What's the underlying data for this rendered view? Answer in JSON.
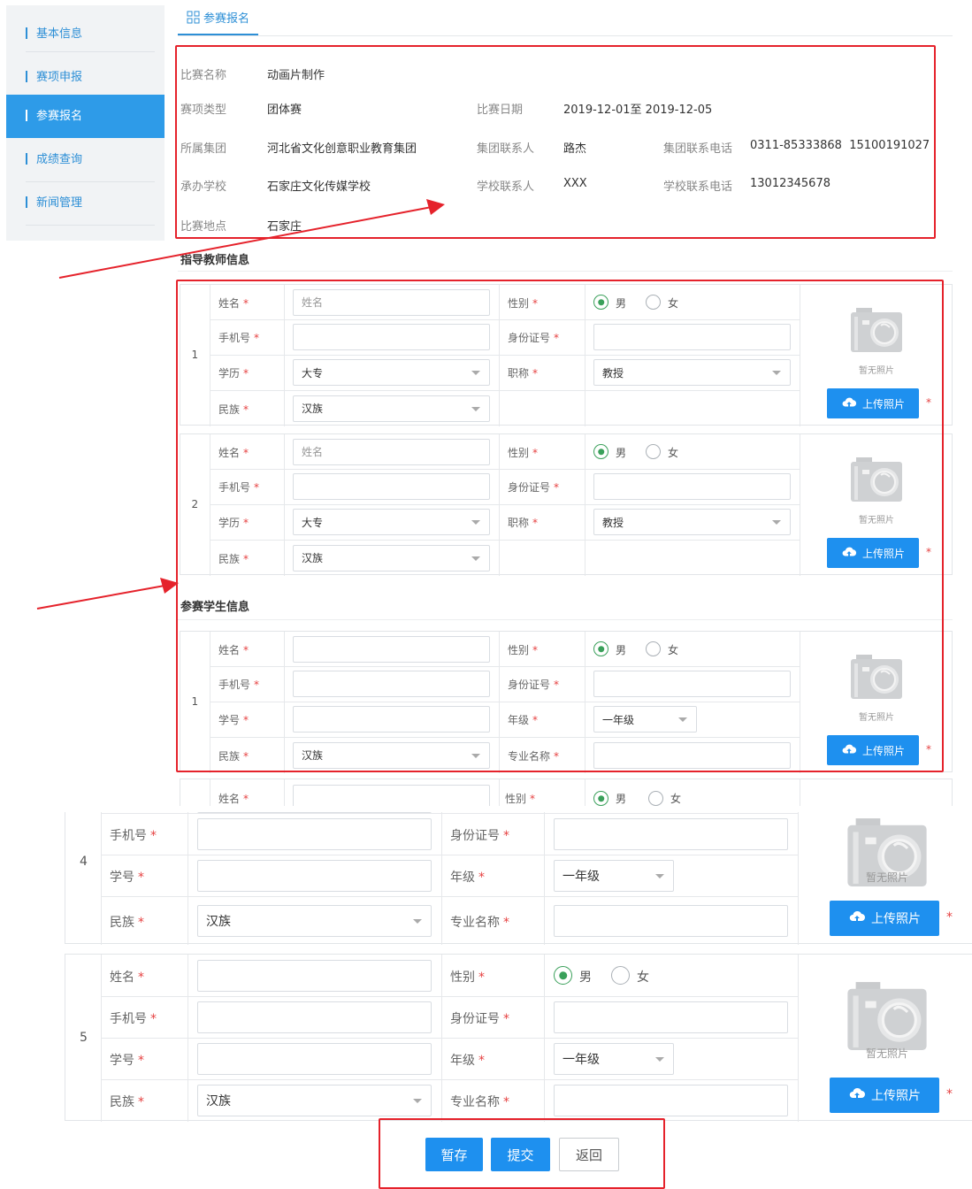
{
  "sidebar": {
    "items": [
      {
        "label": "基本信息",
        "active": false
      },
      {
        "label": "赛项申报",
        "active": false
      },
      {
        "label": "参赛报名",
        "active": true
      },
      {
        "label": "成绩查询",
        "active": false
      },
      {
        "label": "新闻管理",
        "active": false
      }
    ]
  },
  "tab": {
    "icon": "grid-icon",
    "label": "参赛报名"
  },
  "competition": {
    "name_label": "比赛名称",
    "name": "动画片制作",
    "type_label": "赛项类型",
    "type": "团体赛",
    "date_label": "比赛日期",
    "date": "2019-12-01至 2019-12-05",
    "group_label": "所属集团",
    "group": "河北省文化创意职业教育集团",
    "group_contact_label": "集团联系人",
    "group_contact": "路杰",
    "group_phone_label": "集团联系电话",
    "group_phone": "0311-85333868  15100191027",
    "school_label": "承办学校",
    "school": "石家庄文化传媒学校",
    "school_contact_label": "学校联系人",
    "school_contact": "XXX",
    "school_phone_label": "学校联系电话",
    "school_phone": "13012345678",
    "place_label": "比赛地点",
    "place": "石家庄"
  },
  "teacher_section_title": "指导教师信息",
  "student_section_title": "参赛学生信息",
  "labels": {
    "name": "姓名",
    "phone": "手机号",
    "education": "学历",
    "ethnicity": "民族",
    "gender": "性别",
    "id_card": "身份证号",
    "title": "职称",
    "student_no": "学号",
    "grade": "年级",
    "major": "专业名称",
    "required": "*",
    "male": "男",
    "female": "女",
    "no_photo": "暂无照片",
    "upload": "上传照片",
    "name_placeholder": "姓名"
  },
  "teachers": [
    {
      "index": "1",
      "education": "大专",
      "title": "教授",
      "ethnicity": "汉族",
      "gender": "男"
    },
    {
      "index": "2",
      "education": "大专",
      "title": "教授",
      "ethnicity": "汉族",
      "gender": "男"
    }
  ],
  "students": [
    {
      "index": "1",
      "grade": "一年级",
      "ethnicity": "汉族",
      "gender": "男"
    },
    {
      "index": "4",
      "grade": "一年级",
      "ethnicity": "汉族",
      "gender": "男"
    },
    {
      "index": "5",
      "grade": "一年级",
      "ethnicity": "汉族",
      "gender": "男"
    }
  ],
  "buttons": {
    "save": "暂存",
    "submit": "提交",
    "back": "返回"
  },
  "colors": {
    "accent": "#2e9be8",
    "upload": "#1e90ef",
    "required": "#e64242",
    "highlight": "#e5222b",
    "radio": "#3aa05a"
  }
}
